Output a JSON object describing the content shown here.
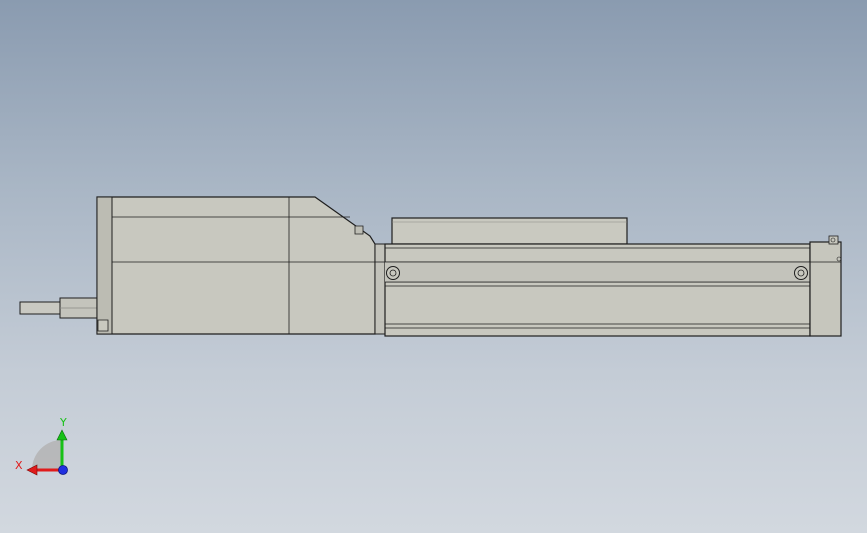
{
  "viewport": {
    "background_top": "#8a9bb0",
    "background_bottom": "#d2d8df"
  },
  "model": {
    "body_color": "#c8c8bf",
    "body_shade": "#b9b9b0",
    "edge_color": "#1e1e1e"
  },
  "triad": {
    "x_label": "X",
    "y_label": "Y",
    "x_color": "#e01b1b",
    "y_color": "#17c117",
    "z_color": "#1f2fe0"
  }
}
